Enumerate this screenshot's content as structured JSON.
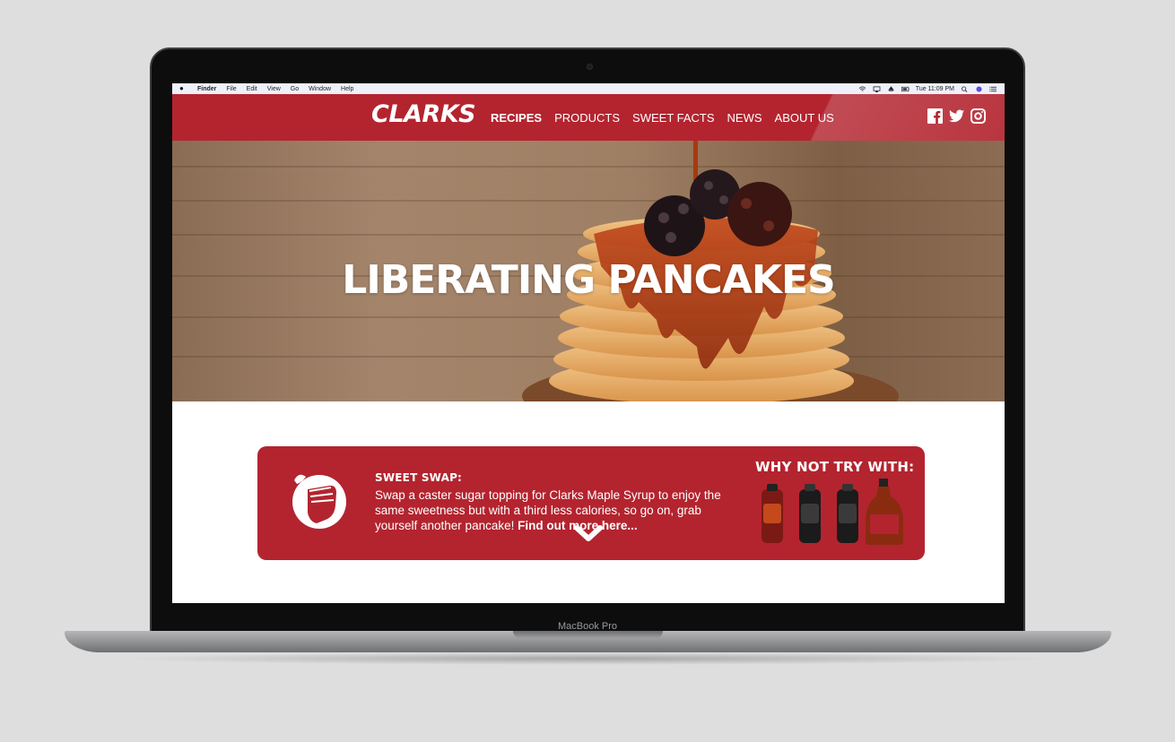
{
  "device": {
    "model_label": "MacBook Pro"
  },
  "menubar": {
    "items": [
      "Finder",
      "File",
      "Edit",
      "View",
      "Go",
      "Window",
      "Help"
    ],
    "clock": "Tue 11:09 PM"
  },
  "site": {
    "logo": "CLARKS",
    "nav": [
      "RECIPES",
      "PRODUCTS",
      "SWEET FACTS",
      "NEWS",
      "ABOUT US"
    ],
    "social_icons": [
      "facebook-icon",
      "twitter-icon",
      "instagram-icon"
    ],
    "accent_color": "#b3242f"
  },
  "hero": {
    "title": "LIBERATING PANCAKES"
  },
  "promo": {
    "swap_title": "SWEET SWAP:",
    "swap_text": "Swap a caster sugar topping for Clarks Maple Syrup to enjoy the same sweetness but with a third less calories, so go on, grab yourself another pancake!",
    "swap_link": "Find out more here...",
    "try_title": "WHY NOT TRY WITH:"
  }
}
